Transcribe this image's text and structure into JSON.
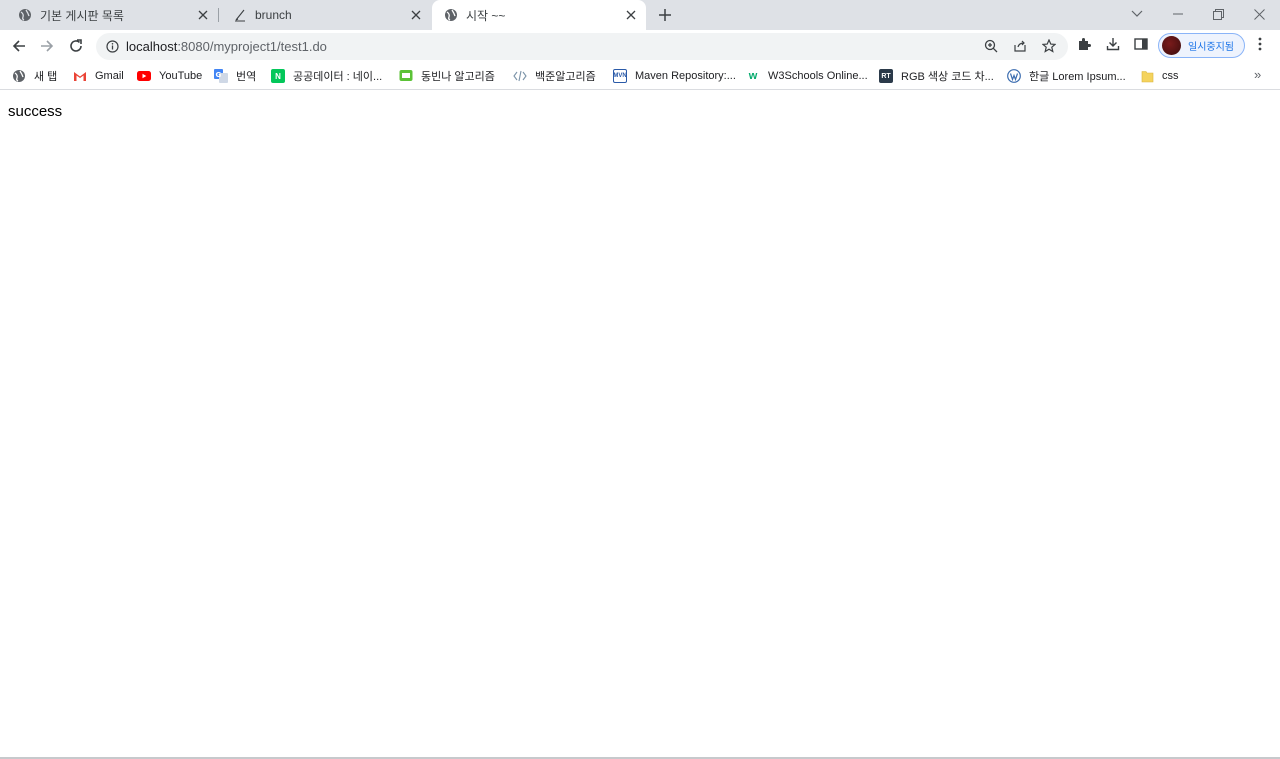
{
  "tabs": [
    {
      "title": "기본 게시판 목록",
      "icon": "globe-icon",
      "active": false
    },
    {
      "title": "brunch",
      "icon": "brunch-pen-icon",
      "active": false
    },
    {
      "title": "시작 ~~",
      "icon": "globe-icon",
      "active": true
    }
  ],
  "address_bar": {
    "host": "localhost",
    "path": ":8080/myproject1/test1.do"
  },
  "profile": {
    "label": "일시중지됨"
  },
  "bookmarks": [
    {
      "label": "새 탭",
      "icon": "globe-icon",
      "color": "#5f6368"
    },
    {
      "label": "Gmail",
      "icon": "gmail-icon",
      "color": "#ea4335"
    },
    {
      "label": "YouTube",
      "icon": "youtube-icon",
      "color": "#ff0000"
    },
    {
      "label": "번역",
      "icon": "translate-icon",
      "color": "#4285f4"
    },
    {
      "label": "공공데이터 : 네이...",
      "icon": "naver-icon",
      "color": "#03c75a"
    },
    {
      "label": "동빈나 알고리즘",
      "icon": "chat-icon",
      "color": "#5bc236"
    },
    {
      "label": "백준알고리즘",
      "icon": "code-icon",
      "color": "#5f6368"
    },
    {
      "label": "Maven Repository:...",
      "icon": "maven-icon",
      "color": "#2a5aa8"
    },
    {
      "label": "W3Schools Online...",
      "icon": "w3schools-icon",
      "color": "#04aa6d"
    },
    {
      "label": "RGB 색상 코드 차...",
      "icon": "rt-icon",
      "color": "#2b3a4a"
    },
    {
      "label": "한글 Lorem Ipsum...",
      "icon": "wordpress-icon",
      "color": "#3c6db0"
    },
    {
      "label": "css",
      "icon": "folder-icon",
      "color": "#f4d35e"
    }
  ],
  "bookmarks_more": "»",
  "page": {
    "text": "success"
  }
}
